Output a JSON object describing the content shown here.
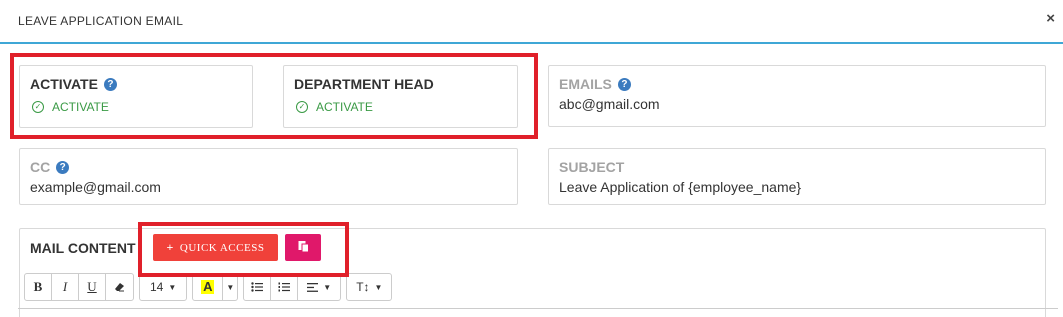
{
  "modal": {
    "title": "LEAVE APPLICATION EMAIL",
    "close": "×"
  },
  "fields": {
    "activate": {
      "label": "ACTIVATE",
      "help": "?",
      "status": "ACTIVATE"
    },
    "department_head": {
      "label": "DEPARTMENT HEAD",
      "status": "ACTIVATE"
    },
    "emails": {
      "label": "EMAILS",
      "help": "?",
      "value": "abc@gmail.com"
    },
    "cc": {
      "label": "CC",
      "help": "?",
      "value": "example@gmail.com"
    },
    "subject": {
      "label": "SUBJECT",
      "value": "Leave Application of {employee_name}"
    }
  },
  "mail_content": {
    "label": "MAIL CONTENT",
    "quick_access": "QUICK ACCESS",
    "quick_access_icon": "plus-icon",
    "paste_icon": "paste-icon"
  },
  "toolbar": {
    "bold": "B",
    "italic": "I",
    "underline": "U",
    "eraser_icon": "eraser-icon",
    "font_size": "14",
    "color_letter": "A",
    "unordered_list_icon": "unordered-list-icon",
    "ordered_list_icon": "ordered-list-icon",
    "align_icon": "align-icon",
    "line_height_icon": "text-height-icon"
  },
  "colors": {
    "accent": "#3fa7d6",
    "highlight_border": "#e0202a",
    "quick_access_bg": "#f0413a",
    "paste_bg": "#e0186a",
    "active_green": "#3a9a45",
    "help_blue": "#3b7bbf"
  }
}
